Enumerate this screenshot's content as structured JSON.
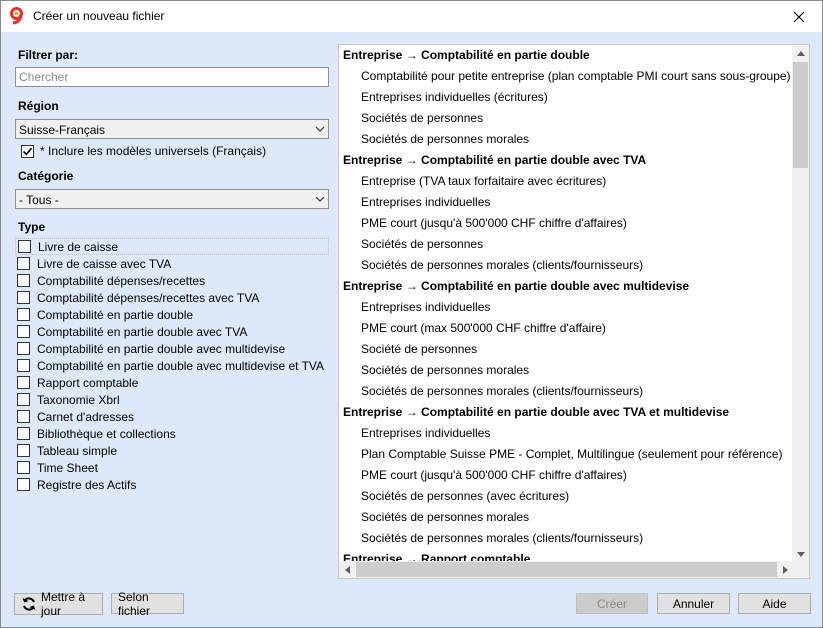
{
  "window": {
    "title": "Créer un nouveau fichier",
    "close_glyph": "×"
  },
  "filter": {
    "label": "Filtrer par:",
    "search_placeholder": "Chercher"
  },
  "region": {
    "label": "Région",
    "selected": "Suisse-Français",
    "include_universal_label": "* Inclure les modèles universels (Français)",
    "include_universal_checked": true
  },
  "category": {
    "label": "Catégorie",
    "selected": "- Tous -"
  },
  "type": {
    "label": "Type",
    "items": [
      "Livre de caisse",
      "Livre de caisse avec TVA",
      "Comptabilité dépenses/recettes",
      "Comptabilité dépenses/recettes avec TVA",
      "Comptabilité en partie double",
      "Comptabilité en partie double avec TVA",
      "Comptabilité en partie double avec multidevise",
      "Comptabilité en partie double avec multidevise et TVA",
      "Rapport comptable",
      "Taxonomie Xbrl",
      "Carnet d'adresses",
      "Bibliothèque et collections",
      "Tableau simple",
      "Time Sheet",
      "Registre des Actifs"
    ]
  },
  "templates": {
    "groups": [
      {
        "title": "Entreprise → Comptabilité en partie double",
        "items": [
          "Comptabilité pour petite entreprise (plan comptable PMI court sans sous-groupe)",
          "Entreprises individuelles (écritures)",
          "Sociétés de personnes",
          "Sociétés de personnes morales"
        ]
      },
      {
        "title": "Entreprise → Comptabilité en partie double avec TVA",
        "items": [
          "Entreprise (TVA taux forfaitaire avec écritures)",
          "Entreprises individuelles",
          "PME court (jusqu'à 500'000 CHF chiffre d'affaires)",
          "Sociétés de personnes",
          "Sociétés de personnes morales (clients/fournisseurs)"
        ]
      },
      {
        "title": "Entreprise → Comptabilité en partie double avec multidevise",
        "items": [
          "Entreprises individuelles",
          "PME court (max 500'000 CHF chiffre d'affaire)",
          "Société de personnes",
          "Sociétés de personnes morales",
          "Sociétés de personnes morales (clients/fournisseurs)"
        ]
      },
      {
        "title": "Entreprise → Comptabilité en partie double avec TVA et multidevise",
        "items": [
          "Entreprises individuelles",
          "Plan Comptable Suisse PME - Complet, Multilingue (seulement pour référence)",
          "PME court (jusqu'à 500'000 CHF chiffre d'affaires)",
          "Sociétés de personnes (avec écritures)",
          "Sociétés de personnes morales",
          "Sociétés de personnes morales (clients/fournisseurs)"
        ]
      },
      {
        "title": "Entreprise → Rapport comptable",
        "items": []
      }
    ]
  },
  "buttons": {
    "update": "Mettre à jour",
    "by_file": "Selon fichier",
    "create": "Créer",
    "cancel": "Annuler",
    "help": "Aide"
  },
  "icons": {
    "app": "banana-9-logo-icon",
    "refresh": "refresh-icon",
    "close": "close-icon",
    "dropdown": "chevron-down-icon",
    "check": "check-icon"
  },
  "colors": {
    "dialog_bg": "#dde9f8",
    "logo_red": "#e8312f",
    "logo_orange": "#f7a51c"
  }
}
